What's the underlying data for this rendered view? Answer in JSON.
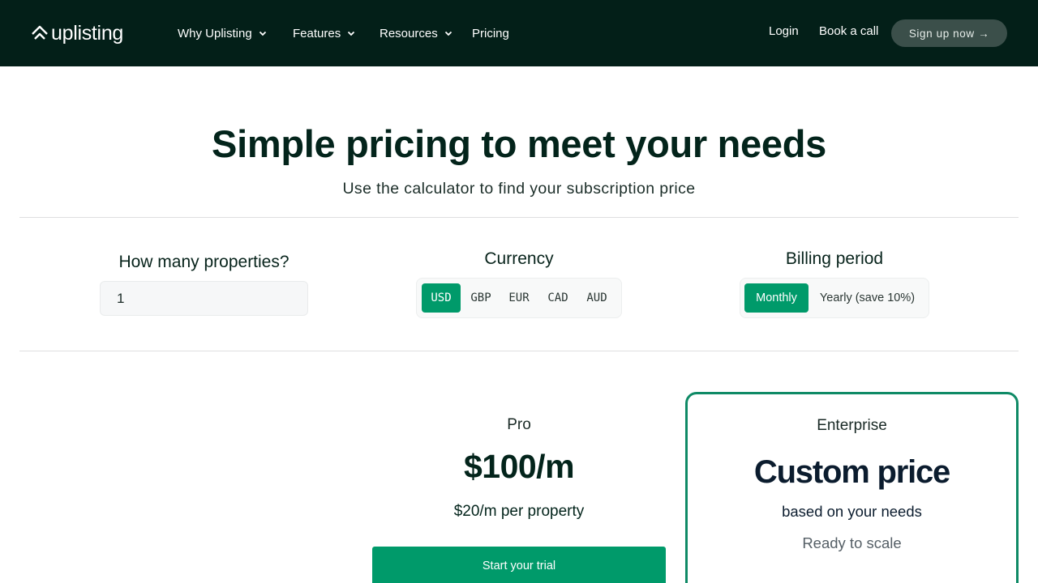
{
  "nav": {
    "logo_text": "uplisting",
    "items": [
      {
        "label": "Why Uplisting",
        "has_dropdown": true
      },
      {
        "label": "Features",
        "has_dropdown": true
      },
      {
        "label": "Resources",
        "has_dropdown": true
      },
      {
        "label": "Pricing",
        "has_dropdown": false
      }
    ],
    "login": "Login",
    "book_call": "Book a call",
    "signup": "Sign up now →"
  },
  "hero": {
    "title": "Simple pricing to meet your needs",
    "subtitle": "Use the calculator to find your subscription price"
  },
  "calculator": {
    "properties_label": "How many properties?",
    "properties_value": "1",
    "currency_label": "Currency",
    "currencies": [
      "USD",
      "GBP",
      "EUR",
      "CAD",
      "AUD"
    ],
    "selected_currency": "USD",
    "billing_label": "Billing period",
    "billing_options": [
      "Monthly",
      "Yearly (save 10%)"
    ],
    "selected_billing": "Monthly"
  },
  "plans": {
    "pro": {
      "name": "Pro",
      "price": "$100/m",
      "per_property": "$20/m per property",
      "cta": "Start your trial"
    },
    "enterprise": {
      "name": "Enterprise",
      "price": "Custom price",
      "subtitle": "based on your needs",
      "tagline": "Ready to scale"
    }
  },
  "colors": {
    "nav_bg": "#031f18",
    "accent": "#009a6a",
    "enterprise_border": "#0f8a66",
    "signup_bg": "#3b4f4a"
  }
}
